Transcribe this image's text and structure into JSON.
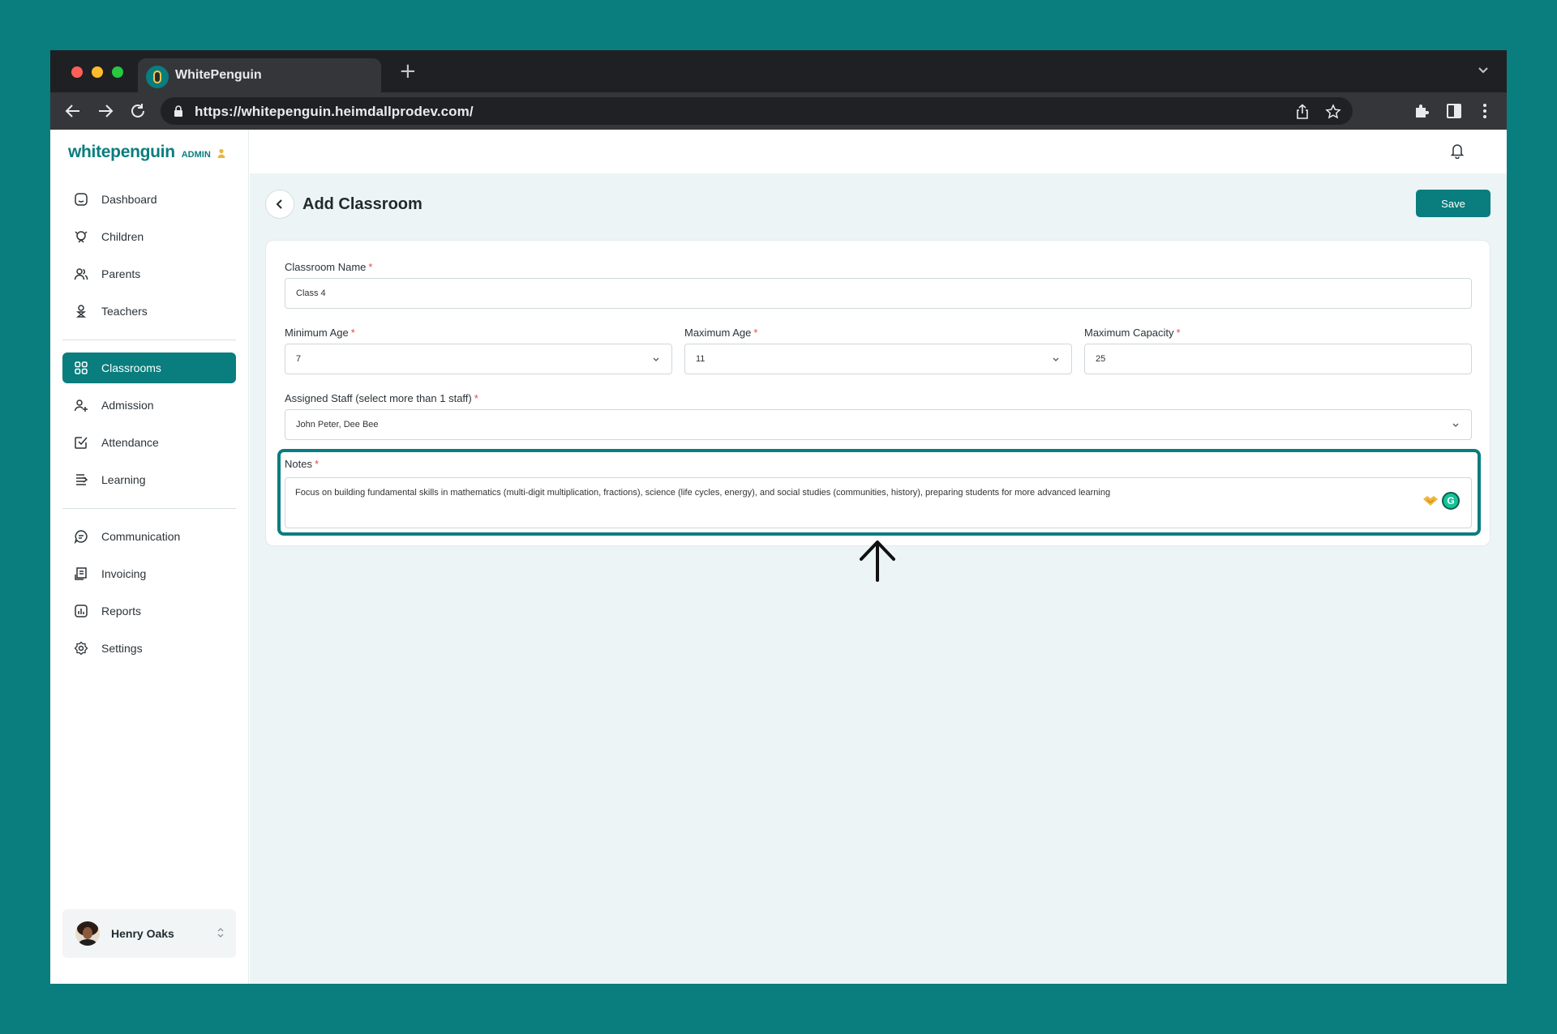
{
  "browser": {
    "tab_title": "WhitePenguin",
    "url": "https://whitepenguin.heimdallprodev.com/"
  },
  "brand": {
    "logo_text": "whitepenguin",
    "role_badge": "ADMIN",
    "accent_color": "#0a7d7e"
  },
  "sidebar": {
    "items": [
      {
        "label": "Dashboard",
        "icon": "home-icon"
      },
      {
        "label": "Children",
        "icon": "child-icon"
      },
      {
        "label": "Parents",
        "icon": "users-icon"
      },
      {
        "label": "Teachers",
        "icon": "teacher-icon"
      },
      {
        "label": "Classrooms",
        "icon": "grid-icon",
        "active": true
      },
      {
        "label": "Admission",
        "icon": "user-plus-icon"
      },
      {
        "label": "Attendance",
        "icon": "check-square-icon"
      },
      {
        "label": "Learning",
        "icon": "book-icon"
      },
      {
        "label": "Communication",
        "icon": "chat-icon"
      },
      {
        "label": "Invoicing",
        "icon": "invoice-icon"
      },
      {
        "label": "Reports",
        "icon": "chart-icon"
      },
      {
        "label": "Settings",
        "icon": "gear-icon"
      }
    ],
    "user": {
      "name": "Henry Oaks"
    }
  },
  "page": {
    "title": "Add Classroom",
    "save_label": "Save"
  },
  "form": {
    "classroom_name": {
      "label": "Classroom Name",
      "required": "*",
      "value": "Class 4"
    },
    "minimum_age": {
      "label": "Minimum Age",
      "required": "*",
      "value": "7"
    },
    "maximum_age": {
      "label": "Maximum Age",
      "required": "*",
      "value": "11"
    },
    "maximum_capacity": {
      "label": "Maximum Capacity",
      "required": "*",
      "value": "25"
    },
    "assigned_staff": {
      "label": "Assigned Staff (select more than 1 staff)",
      "required": "*",
      "value": "John Peter, Dee Bee"
    },
    "notes": {
      "label": "Notes",
      "required": "*",
      "value": "Focus on building fundamental skills in mathematics (multi-digit multiplication, fractions), science (life cycles, energy), and social studies (communities, history), preparing students for more advanced learning"
    }
  }
}
